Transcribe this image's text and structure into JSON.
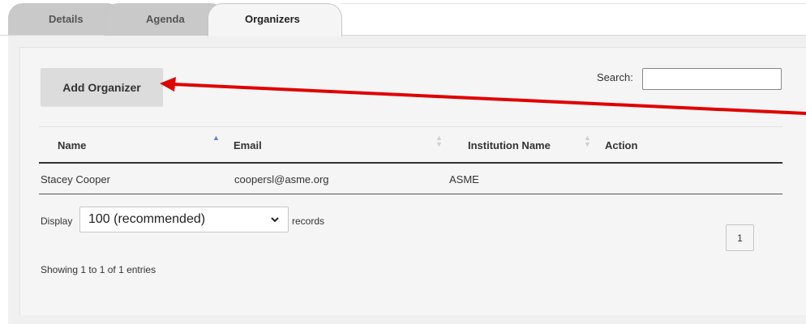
{
  "tabs": [
    {
      "label": "Details"
    },
    {
      "label": "Agenda"
    },
    {
      "label": "Organizers"
    }
  ],
  "toolbar": {
    "add_label": "Add Organizer"
  },
  "search": {
    "label": "Search:",
    "value": ""
  },
  "table": {
    "columns": [
      "Name",
      "Email",
      "Institution Name",
      "Action"
    ],
    "rows": [
      {
        "name": "Stacey Cooper",
        "email": "coopersl@asme.org",
        "institution": "ASME",
        "action": ""
      }
    ]
  },
  "length": {
    "label_before": "Display",
    "selected": "100 (recommended)",
    "label_after": "records"
  },
  "pagination": {
    "current_page": "1"
  },
  "info": {
    "text": "Showing 1 to 1 of 1 entries"
  },
  "colors": {
    "annotation_arrow": "#e00000",
    "sort_active": "#5b7fd6"
  }
}
